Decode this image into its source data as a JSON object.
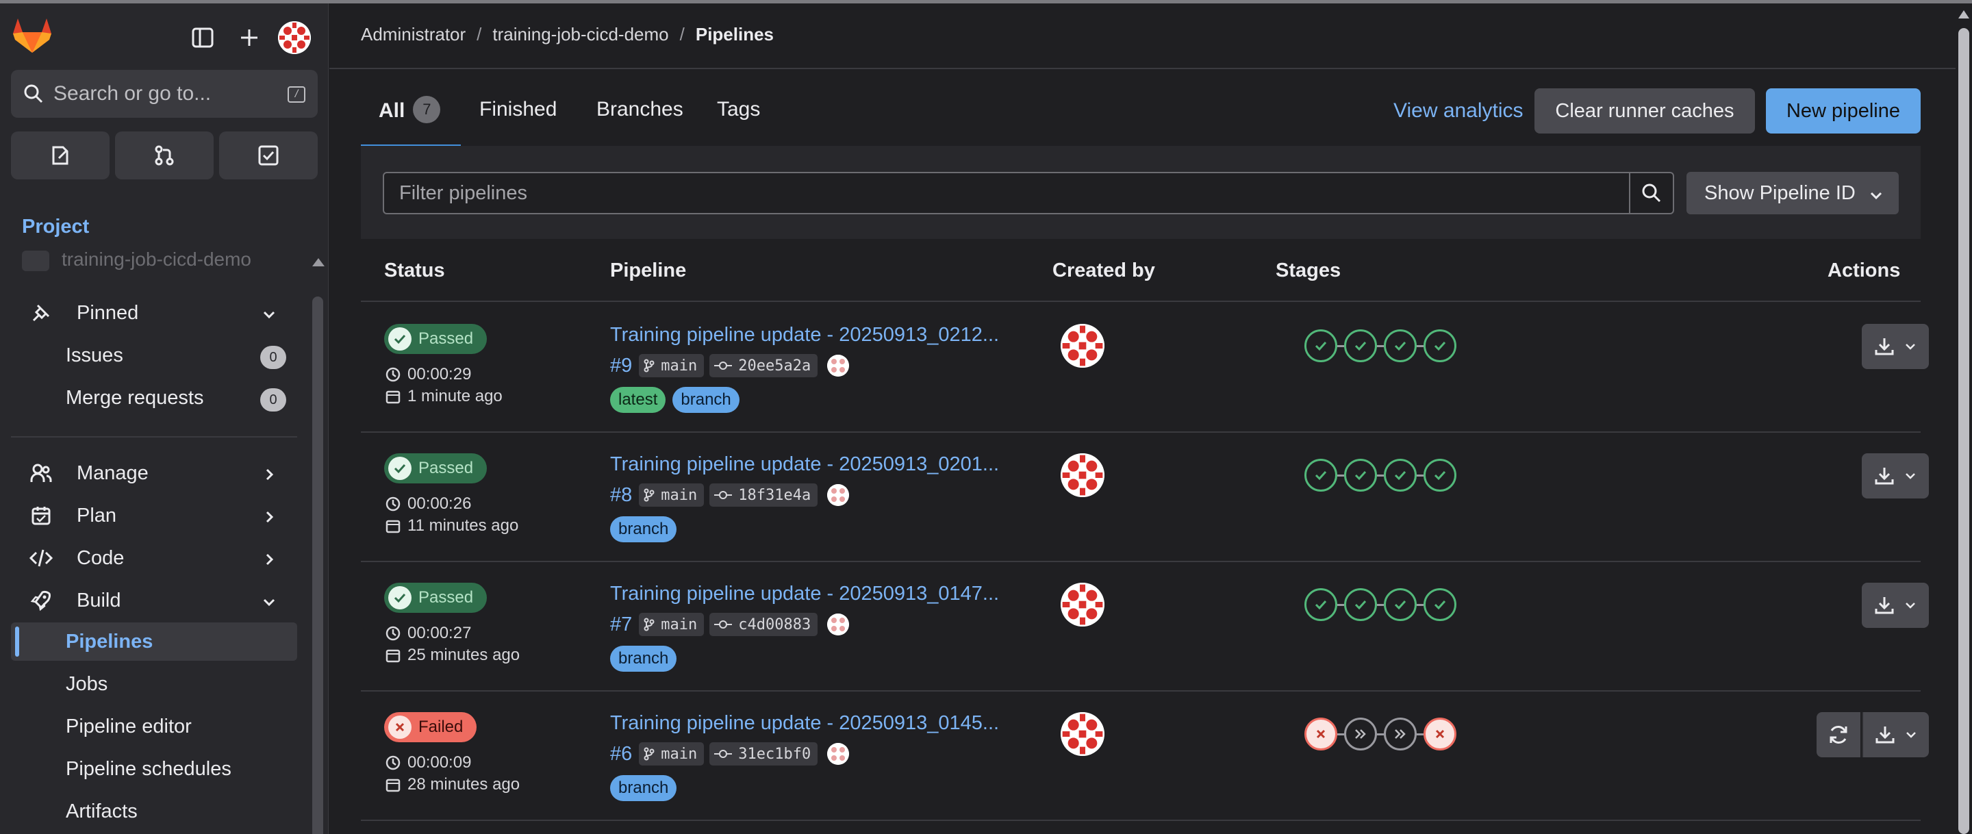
{
  "sidebar": {
    "search_placeholder": "Search or go to...",
    "search_shortcut": "/",
    "section_label": "Project",
    "project_name": "training-job-cicd-demo",
    "pinned_label": "Pinned",
    "pinned_items": [
      {
        "label": "Issues",
        "count": "0"
      },
      {
        "label": "Merge requests",
        "count": "0"
      }
    ],
    "groups": [
      {
        "label": "Manage"
      },
      {
        "label": "Plan"
      },
      {
        "label": "Code"
      },
      {
        "label": "Build"
      }
    ],
    "build_items": [
      {
        "label": "Pipelines"
      },
      {
        "label": "Jobs"
      },
      {
        "label": "Pipeline editor"
      },
      {
        "label": "Pipeline schedules"
      },
      {
        "label": "Artifacts"
      }
    ]
  },
  "breadcrumb": {
    "items": [
      "Administrator",
      "training-job-cicd-demo",
      "Pipelines"
    ],
    "separator": "/"
  },
  "tabs": [
    {
      "label": "All",
      "count": "7"
    },
    {
      "label": "Finished"
    },
    {
      "label": "Branches"
    },
    {
      "label": "Tags"
    }
  ],
  "actions": {
    "view_analytics": "View analytics",
    "clear_caches": "Clear runner caches",
    "new_pipeline": "New pipeline"
  },
  "filter": {
    "placeholder": "Filter pipelines",
    "dropdown_label": "Show Pipeline ID"
  },
  "table": {
    "headers": {
      "status": "Status",
      "pipeline": "Pipeline",
      "created_by": "Created by",
      "stages": "Stages",
      "actions": "Actions"
    },
    "rows": [
      {
        "status": "Passed",
        "duration": "00:00:29",
        "finished": "1 minute ago",
        "title": "Training pipeline update - 20250913_0212...",
        "id": "#9",
        "branch": "main",
        "commit": "20ee5a2a",
        "tags": [
          "latest",
          "branch"
        ],
        "stages": [
          "success",
          "success",
          "success",
          "success"
        ],
        "retry": false
      },
      {
        "status": "Passed",
        "duration": "00:00:26",
        "finished": "11 minutes ago",
        "title": "Training pipeline update - 20250913_0201...",
        "id": "#8",
        "branch": "main",
        "commit": "18f31e4a",
        "tags": [
          "branch"
        ],
        "stages": [
          "success",
          "success",
          "success",
          "success"
        ],
        "retry": false
      },
      {
        "status": "Passed",
        "duration": "00:00:27",
        "finished": "25 minutes ago",
        "title": "Training pipeline update - 20250913_0147...",
        "id": "#7",
        "branch": "main",
        "commit": "c4d00883",
        "tags": [
          "branch"
        ],
        "stages": [
          "success",
          "success",
          "success",
          "success"
        ],
        "retry": false
      },
      {
        "status": "Failed",
        "duration": "00:00:09",
        "finished": "28 minutes ago",
        "title": "Training pipeline update - 20250913_0145...",
        "id": "#6",
        "branch": "main",
        "commit": "31ec1bf0",
        "tags": [
          "branch"
        ],
        "stages": [
          "failed",
          "skipped",
          "skipped",
          "failed"
        ],
        "retry": true
      }
    ]
  },
  "colors": {
    "accent": "#7cb4f5",
    "success": "#52b87a",
    "danger": "#ee6b60",
    "background": "#1f1f22",
    "sidebar": "#28282c"
  },
  "icons": [
    "tanuki-logo-icon",
    "sidebar-toggle-icon",
    "plus-icon",
    "search-icon",
    "issues-icon",
    "merge-request-icon",
    "todo-icon",
    "pin-icon",
    "users-icon",
    "calendar-icon",
    "code-icon",
    "rocket-icon",
    "chevron-down-icon",
    "chevron-right-icon",
    "clock-icon",
    "branch-icon",
    "commit-icon",
    "download-icon",
    "retry-icon",
    "check-icon",
    "close-icon",
    "skip-icon"
  ]
}
